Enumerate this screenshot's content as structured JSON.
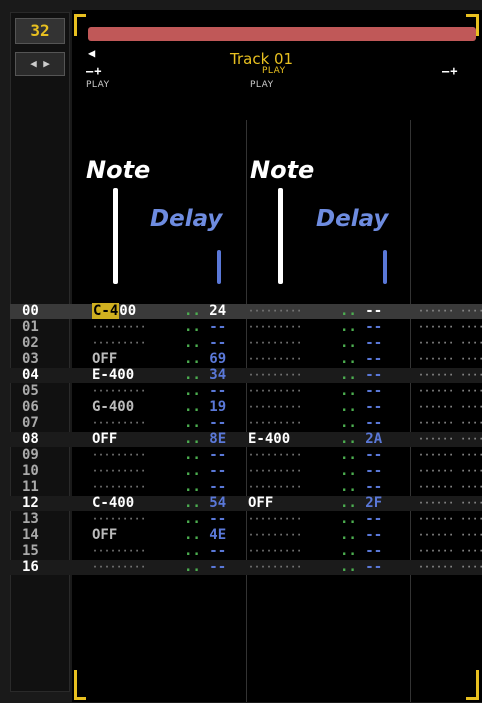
{
  "lines_count": "32",
  "nav_arrows": "◀ ▶",
  "track": {
    "title": "Track 01",
    "play_label_top": "PLAY",
    "play_label_col1": "PLAY",
    "play_label_col2": "PLAY",
    "minus_plus": "–+"
  },
  "columns": {
    "note1": "Note",
    "delay1": "Delay",
    "note2": "Note",
    "delay2": "Delay"
  },
  "empty_note": "·········",
  "empty_col": "······ ······",
  "rows": [
    {
      "n": "00",
      "note": "C-4",
      "inst": "00",
      "vol": "..",
      "delay": "24",
      "note2": "",
      "vol2": "..",
      "delay2": "--"
    },
    {
      "n": "01",
      "note": "",
      "inst": "",
      "vol": "..",
      "delay": "--",
      "note2": "",
      "vol2": "..",
      "delay2": "--"
    },
    {
      "n": "02",
      "note": "",
      "inst": "",
      "vol": "..",
      "delay": "--",
      "note2": "",
      "vol2": "..",
      "delay2": "--"
    },
    {
      "n": "03",
      "note": "OFF",
      "inst": "",
      "vol": "..",
      "delay": "69",
      "note2": "",
      "vol2": "..",
      "delay2": "--"
    },
    {
      "n": "04",
      "note": "E-400",
      "inst": "",
      "vol": "..",
      "delay": "34",
      "note2": "",
      "vol2": "..",
      "delay2": "--"
    },
    {
      "n": "05",
      "note": "",
      "inst": "",
      "vol": "..",
      "delay": "--",
      "note2": "",
      "vol2": "..",
      "delay2": "--"
    },
    {
      "n": "06",
      "note": "G-400",
      "inst": "",
      "vol": "..",
      "delay": "19",
      "note2": "",
      "vol2": "..",
      "delay2": "--"
    },
    {
      "n": "07",
      "note": "",
      "inst": "",
      "vol": "..",
      "delay": "--",
      "note2": "",
      "vol2": "..",
      "delay2": "--"
    },
    {
      "n": "08",
      "note": "OFF",
      "inst": "",
      "vol": "..",
      "delay": "8E",
      "note2": "E-400",
      "vol2": "..",
      "delay2": "2A"
    },
    {
      "n": "09",
      "note": "",
      "inst": "",
      "vol": "..",
      "delay": "--",
      "note2": "",
      "vol2": "..",
      "delay2": "--"
    },
    {
      "n": "10",
      "note": "",
      "inst": "",
      "vol": "..",
      "delay": "--",
      "note2": "",
      "vol2": "..",
      "delay2": "--"
    },
    {
      "n": "11",
      "note": "",
      "inst": "",
      "vol": "..",
      "delay": "--",
      "note2": "",
      "vol2": "..",
      "delay2": "--"
    },
    {
      "n": "12",
      "note": "C-400",
      "inst": "",
      "vol": "..",
      "delay": "54",
      "note2": "OFF",
      "vol2": "..",
      "delay2": "2F"
    },
    {
      "n": "13",
      "note": "",
      "inst": "",
      "vol": "..",
      "delay": "--",
      "note2": "",
      "vol2": "..",
      "delay2": "--"
    },
    {
      "n": "14",
      "note": "OFF",
      "inst": "",
      "vol": "..",
      "delay": "4E",
      "note2": "",
      "vol2": "..",
      "delay2": "--"
    },
    {
      "n": "15",
      "note": "",
      "inst": "",
      "vol": "..",
      "delay": "--",
      "note2": "",
      "vol2": "..",
      "delay2": "--"
    },
    {
      "n": "16",
      "note": "",
      "inst": "",
      "vol": "..",
      "delay": "--",
      "note2": "",
      "vol2": "..",
      "delay2": "--"
    }
  ],
  "colors": {
    "accent": "#e8c020",
    "delay": "#5a78d8",
    "dots": "#4caf50",
    "header_bar": "#c05858"
  }
}
